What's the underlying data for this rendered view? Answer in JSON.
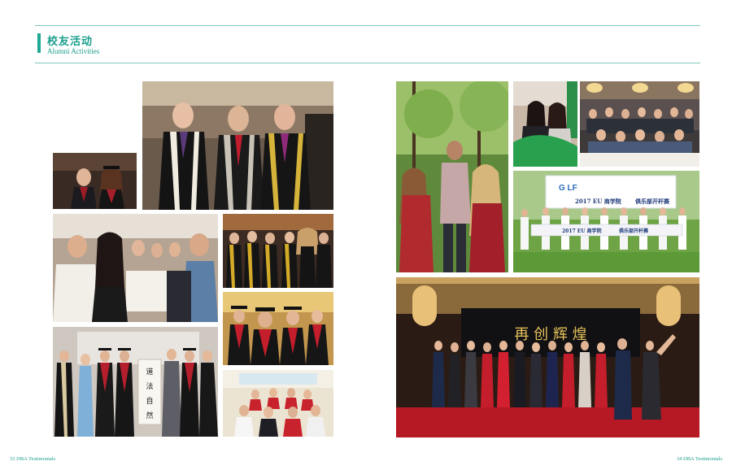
{
  "header": {
    "title_cn": "校友活动",
    "title_en": "Alumni Activities"
  },
  "footer": {
    "left": "33 DBA Testimonials",
    "right": "34 DBA Testimonials"
  },
  "banners": {
    "golf_title": "2017 EU 商学院",
    "golf_subtitle": "俱乐部开杆赛",
    "golf_logo": "G LF",
    "calligraphy": "道法自然",
    "gala_backdrop": "再 创 辉 煌"
  },
  "colors": {
    "accent": "#1a9e8c",
    "rule": "#7cc7bd"
  }
}
